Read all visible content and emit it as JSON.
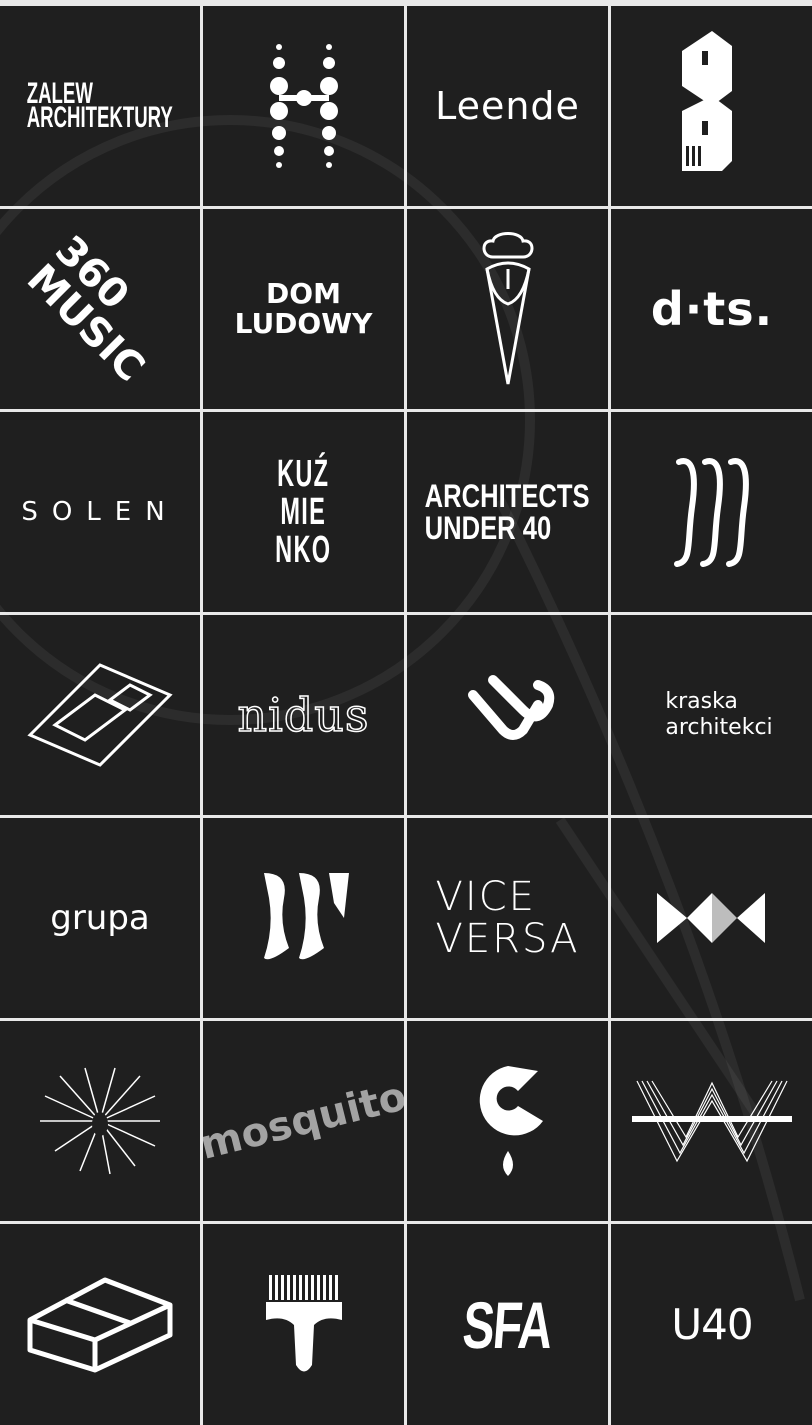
{
  "tiles": {
    "zalew": {
      "line1": "ZALEW",
      "line2": "ARCHITEKTURY"
    },
    "leende": {
      "text": "Leende"
    },
    "music360": {
      "line1": "360",
      "line2": "MUSIC"
    },
    "domludowy": {
      "line1": "DOM",
      "line2": "LUDOWY"
    },
    "dts": {
      "text": "d·ts."
    },
    "solen": {
      "text": "SOLEN"
    },
    "kuzmienko": {
      "line1": "KUŹ",
      "line2": "MIE",
      "line3": "NKO"
    },
    "au40": {
      "line1": "ARCHITECTS",
      "line2": "UNDER 40"
    },
    "nidus": {
      "text": "nidus"
    },
    "kraska": {
      "line1": "kraska",
      "line2": "architekci"
    },
    "grupa": {
      "text": "grupa"
    },
    "viceversa": {
      "line1": "VICE",
      "line2": "VERSA"
    },
    "mosquito": {
      "text": "mosquito"
    },
    "sfa": {
      "text": "SFA"
    },
    "u40": {
      "text": "U40"
    }
  },
  "colors": {
    "tile_bg": "#1f1f1f",
    "grid_line": "#e8e8e8",
    "logo": "#ffffff"
  }
}
